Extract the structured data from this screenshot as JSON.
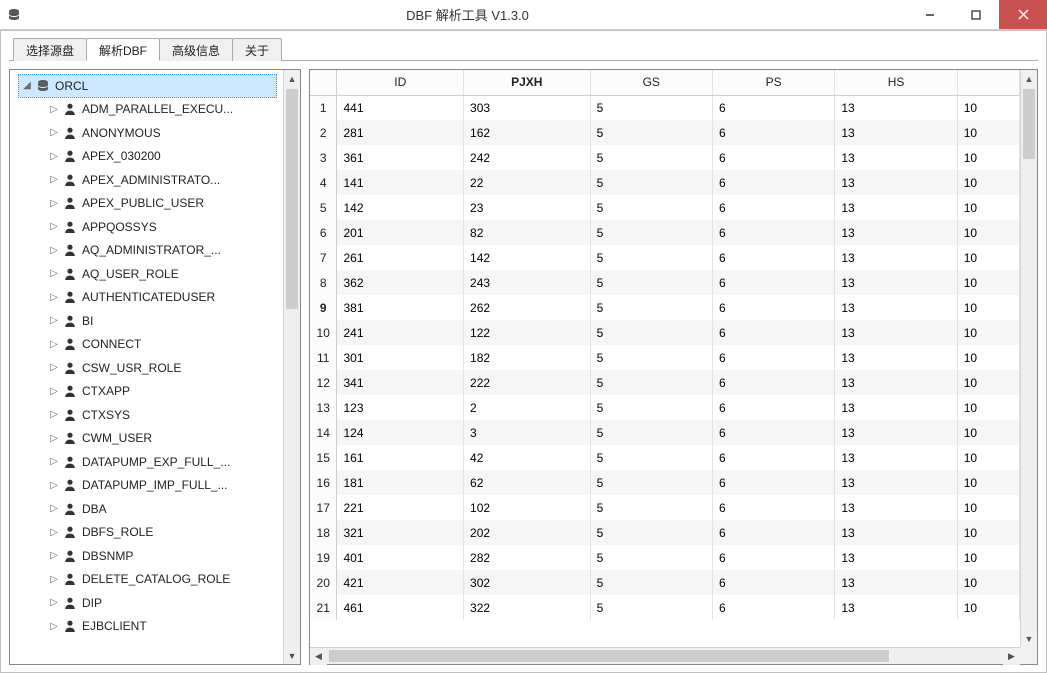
{
  "window": {
    "title": "DBF 解析工具  V1.3.0"
  },
  "tabs": [
    {
      "label": "选择源盘"
    },
    {
      "label": "解析DBF"
    },
    {
      "label": "高级信息"
    },
    {
      "label": "关于"
    }
  ],
  "active_tab_index": 1,
  "tree": {
    "root": "ORCL",
    "nodes": [
      "ADM_PARALLEL_EXECU...",
      "ANONYMOUS",
      "APEX_030200",
      "APEX_ADMINISTRATO...",
      "APEX_PUBLIC_USER",
      "APPQOSSYS",
      "AQ_ADMINISTRATOR_...",
      "AQ_USER_ROLE",
      "AUTHENTICATEDUSER",
      "BI",
      "CONNECT",
      "CSW_USR_ROLE",
      "CTXAPP",
      "CTXSYS",
      "CWM_USER",
      "DATAPUMP_EXP_FULL_...",
      "DATAPUMP_IMP_FULL_...",
      "DBA",
      "DBFS_ROLE",
      "DBSNMP",
      "DELETE_CATALOG_ROLE",
      "DIP",
      "EJBCLIENT"
    ]
  },
  "grid": {
    "columns": [
      "ID",
      "PJXH",
      "GS",
      "PS",
      "HS",
      ""
    ],
    "bold_column_index": 1,
    "rownum_width": 26,
    "rows": [
      {
        "n": "1",
        "c": [
          "441",
          "303",
          "5",
          "6",
          "13",
          "10"
        ]
      },
      {
        "n": "2",
        "c": [
          "281",
          "162",
          "5",
          "6",
          "13",
          "10"
        ]
      },
      {
        "n": "3",
        "c": [
          "361",
          "242",
          "5",
          "6",
          "13",
          "10"
        ]
      },
      {
        "n": "4",
        "c": [
          "141",
          "22",
          "5",
          "6",
          "13",
          "10"
        ]
      },
      {
        "n": "5",
        "c": [
          "142",
          "23",
          "5",
          "6",
          "13",
          "10"
        ]
      },
      {
        "n": "6",
        "c": [
          "201",
          "82",
          "5",
          "6",
          "13",
          "10"
        ]
      },
      {
        "n": "7",
        "c": [
          "261",
          "142",
          "5",
          "6",
          "13",
          "10"
        ]
      },
      {
        "n": "8",
        "c": [
          "362",
          "243",
          "5",
          "6",
          "13",
          "10"
        ]
      },
      {
        "n": "9",
        "c": [
          "381",
          "262",
          "5",
          "6",
          "13",
          "10"
        ]
      },
      {
        "n": "10",
        "c": [
          "241",
          "122",
          "5",
          "6",
          "13",
          "10"
        ]
      },
      {
        "n": "11",
        "c": [
          "301",
          "182",
          "5",
          "6",
          "13",
          "10"
        ]
      },
      {
        "n": "12",
        "c": [
          "341",
          "222",
          "5",
          "6",
          "13",
          "10"
        ]
      },
      {
        "n": "13",
        "c": [
          "123",
          "2",
          "5",
          "6",
          "13",
          "10"
        ]
      },
      {
        "n": "14",
        "c": [
          "124",
          "3",
          "5",
          "6",
          "13",
          "10"
        ]
      },
      {
        "n": "15",
        "c": [
          "161",
          "42",
          "5",
          "6",
          "13",
          "10"
        ]
      },
      {
        "n": "16",
        "c": [
          "181",
          "62",
          "5",
          "6",
          "13",
          "10"
        ]
      },
      {
        "n": "17",
        "c": [
          "221",
          "102",
          "5",
          "6",
          "13",
          "10"
        ]
      },
      {
        "n": "18",
        "c": [
          "321",
          "202",
          "5",
          "6",
          "13",
          "10"
        ]
      },
      {
        "n": "19",
        "c": [
          "401",
          "282",
          "5",
          "6",
          "13",
          "10"
        ]
      },
      {
        "n": "20",
        "c": [
          "421",
          "302",
          "5",
          "6",
          "13",
          "10"
        ]
      },
      {
        "n": "21",
        "c": [
          "461",
          "322",
          "5",
          "6",
          "13",
          "10"
        ]
      }
    ]
  }
}
